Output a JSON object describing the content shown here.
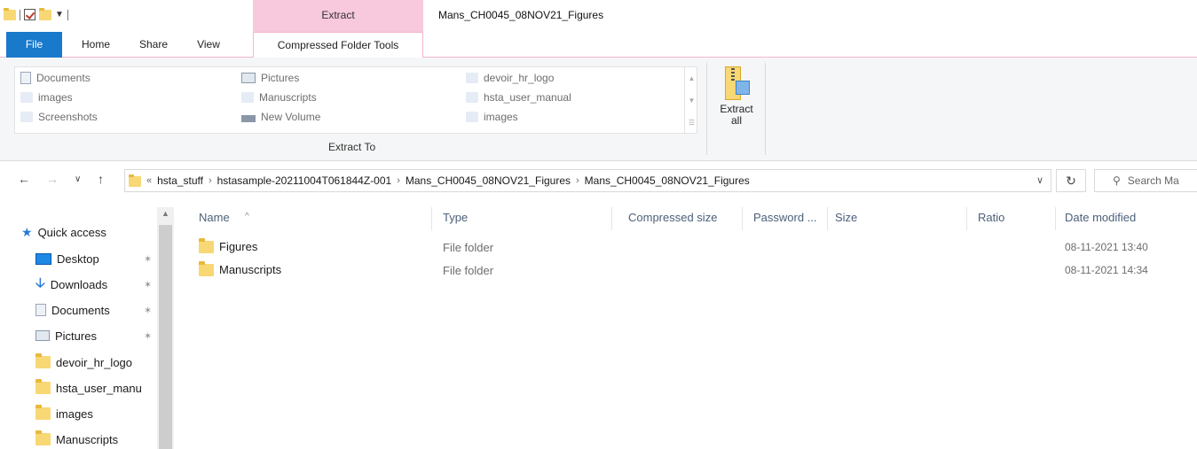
{
  "window": {
    "title": "Mans_CH0045_08NOV21_Figures",
    "context_tab_group": "Extract"
  },
  "ribbon": {
    "tabs": [
      "File",
      "Home",
      "Share",
      "View",
      "Compressed Folder Tools"
    ],
    "gallery_col1": [
      "Documents",
      "images",
      "Screenshots"
    ],
    "gallery_col2": [
      "Pictures",
      "Manuscripts",
      "New Volume"
    ],
    "gallery_col3": [
      "devoir_hr_logo",
      "hsta_user_manual",
      "images"
    ],
    "extract_to_label": "Extract To",
    "extract_all_label": "Extract\nall"
  },
  "address": {
    "overflow": "«",
    "crumbs": [
      "hsta_stuff",
      "hstasample-20211004T061844Z-001",
      "Mans_CH0045_08NOV21_Figures",
      "Mans_CH0045_08NOV21_Figures"
    ],
    "search_placeholder": "Search Ma"
  },
  "navpane": {
    "quick_access": "Quick access",
    "items": [
      "Desktop",
      "Downloads",
      "Documents",
      "Pictures",
      "devoir_hr_logo",
      "hsta_user_manu",
      "images",
      "Manuscripts"
    ]
  },
  "filelist": {
    "columns": [
      "Name",
      "Type",
      "Compressed size",
      "Password ...",
      "Size",
      "Ratio",
      "Date modified"
    ],
    "rows": [
      {
        "name": "Figures",
        "type": "File folder",
        "date": "08-11-2021 13:40"
      },
      {
        "name": "Manuscripts",
        "type": "File folder",
        "date": "08-11-2021 14:34"
      }
    ]
  },
  "colors": {
    "file_tab": "#1979ca",
    "context_tab": "#f8c8dc",
    "folder": "#f8d775",
    "column_header": "#4c607a"
  }
}
